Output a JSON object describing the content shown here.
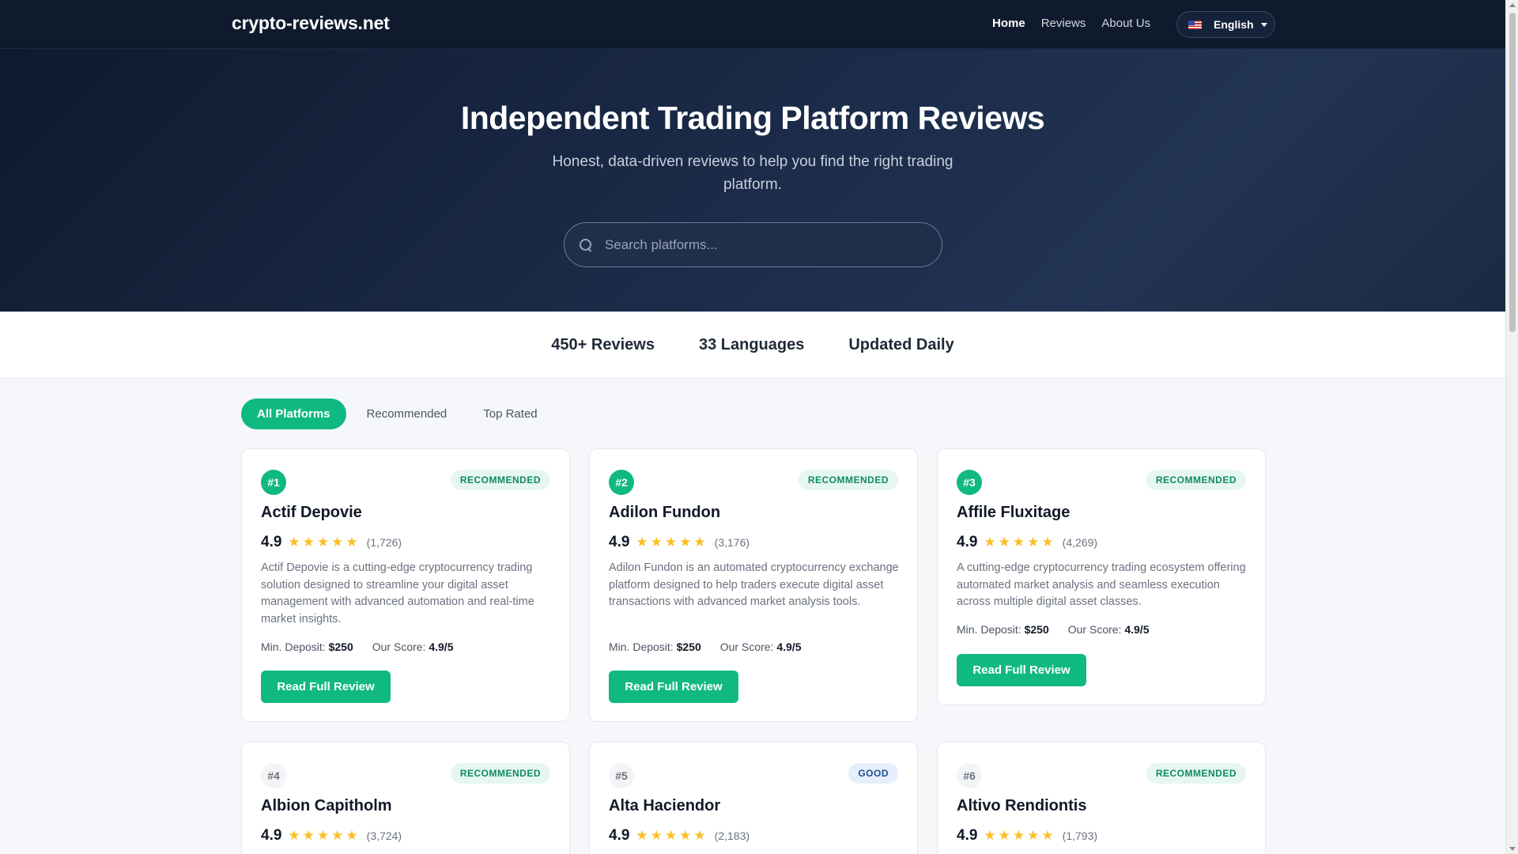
{
  "nav": {
    "brand": "crypto-reviews.net",
    "links": [
      "Home",
      "Reviews",
      "About Us"
    ],
    "language": "English"
  },
  "hero": {
    "title": "Independent Trading Platform Reviews",
    "subtitle": "Honest, data-driven reviews to help you find the right trading platform.",
    "search_placeholder": "Search platforms..."
  },
  "stats": [
    "450+ Reviews",
    "33 Languages",
    "Updated Daily"
  ],
  "filters": [
    "All Platforms",
    "Recommended",
    "Top Rated"
  ],
  "labels": {
    "min_deposit": "Min. Deposit:",
    "our_score": "Our Score:",
    "read_button": "Read Full Review"
  },
  "platforms": [
    {
      "rank": "#1",
      "badge": "RECOMMENDED",
      "name": "Actif Depovie",
      "rating": "4.9",
      "count": "(1,726)",
      "description": "Actif Depovie is a cutting-edge cryptocurrency trading solution designed to streamline your digital asset management with advanced automation and real-time market insights.",
      "deposit": "$250",
      "score": "4.9/5"
    },
    {
      "rank": "#2",
      "badge": "RECOMMENDED",
      "name": "Adilon Fundon",
      "rating": "4.9",
      "count": "(3,176)",
      "description": "Adilon Fundon is an automated cryptocurrency exchange platform designed to help traders execute digital asset transactions with advanced market analysis tools.",
      "deposit": "$250",
      "score": "4.9/5"
    },
    {
      "rank": "#3",
      "badge": "RECOMMENDED",
      "name": "Affile Fluxitage",
      "rating": "4.9",
      "count": "(4,269)",
      "description": "A cutting-edge cryptocurrency trading ecosystem offering automated market analysis and seamless execution across multiple digital asset classes.",
      "deposit": "$250",
      "score": "4.9/5"
    },
    {
      "rank": "#4",
      "badge": "RECOMMENDED",
      "name": "Albion Capitholm",
      "rating": "4.9",
      "count": "(3,724)"
    },
    {
      "rank": "#5",
      "badge": "GOOD",
      "name": "Alta Haciendor",
      "rating": "4.9",
      "count": "(2,183)"
    },
    {
      "rank": "#6",
      "badge": "RECOMMENDED",
      "name": "Altivo Rendiontis",
      "rating": "4.9",
      "count": "(1,793)"
    }
  ],
  "colors": {
    "accent": "#10b981",
    "nav_bg": "#0f1b2d",
    "star": "#fbbf24"
  },
  "icons": {
    "search": "search-icon",
    "flag": "us-flag-icon",
    "caret": "chevron-down-icon",
    "star": "star-icon"
  }
}
